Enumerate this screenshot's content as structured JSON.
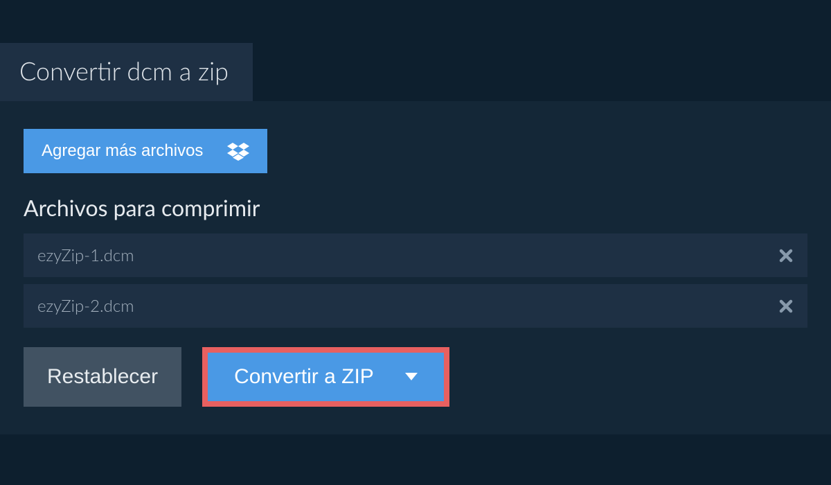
{
  "tab": {
    "title": "Convertir dcm a zip"
  },
  "addFiles": {
    "label": "Agregar más archivos"
  },
  "section": {
    "heading": "Archivos para comprimir"
  },
  "files": [
    {
      "name": "ezyZip-1.dcm"
    },
    {
      "name": "ezyZip-2.dcm"
    }
  ],
  "buttons": {
    "reset": "Restablecer",
    "convert": "Convertir a ZIP"
  }
}
